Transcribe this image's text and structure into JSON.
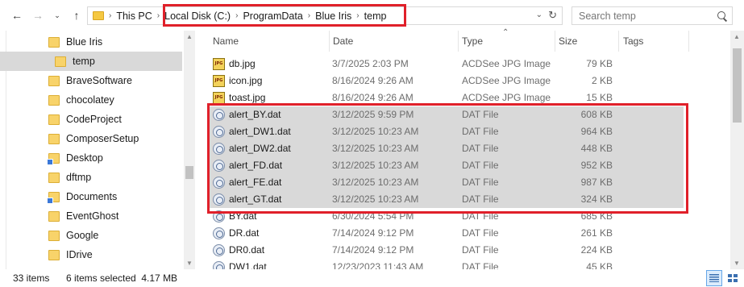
{
  "address_bar": {
    "back_icon": "arrow-left-icon",
    "forward_icon": "arrow-right-icon",
    "recent_icon": "chevron-down-icon",
    "up_icon": "arrow-up-icon",
    "crumbs": [
      "This PC",
      "Local Disk (C:)",
      "ProgramData",
      "Blue Iris",
      "temp"
    ],
    "search_placeholder": "Search temp"
  },
  "nav_pane": {
    "items": [
      {
        "label": "Blue Iris",
        "icon": "folder-icon"
      },
      {
        "label": "temp",
        "icon": "folder-icon",
        "selected": true
      },
      {
        "label": "BraveSoftware",
        "icon": "folder-icon"
      },
      {
        "label": "chocolatey",
        "icon": "folder-icon"
      },
      {
        "label": "CodeProject",
        "icon": "folder-icon"
      },
      {
        "label": "ComposerSetup",
        "icon": "folder-icon"
      },
      {
        "label": "Desktop",
        "icon": "system-folder-icon"
      },
      {
        "label": "dftmp",
        "icon": "folder-icon"
      },
      {
        "label": "Documents",
        "icon": "system-folder-icon"
      },
      {
        "label": "EventGhost",
        "icon": "folder-icon"
      },
      {
        "label": "Google",
        "icon": "folder-icon"
      },
      {
        "label": "IDrive",
        "icon": "folder-icon"
      }
    ]
  },
  "file_list": {
    "columns": [
      "Name",
      "Date",
      "Type",
      "Size",
      "Tags"
    ],
    "rows": [
      {
        "name": "db.jpg",
        "date": "3/7/2025 2:03 PM",
        "type": "ACDSee JPG Image",
        "size": "79 KB",
        "icon": "jpg-file-icon",
        "selected": false
      },
      {
        "name": "icon.jpg",
        "date": "8/16/2024 9:26 AM",
        "type": "ACDSee JPG Image",
        "size": "2 KB",
        "icon": "jpg-file-icon",
        "selected": false
      },
      {
        "name": "toast.jpg",
        "date": "8/16/2024 9:26 AM",
        "type": "ACDSee JPG Image",
        "size": "15 KB",
        "icon": "jpg-file-icon",
        "selected": false
      },
      {
        "name": "alert_BY.dat",
        "date": "3/12/2025 9:59 PM",
        "type": "DAT File",
        "size": "608 KB",
        "icon": "dat-file-icon",
        "selected": true
      },
      {
        "name": "alert_DW1.dat",
        "date": "3/12/2025 10:23 AM",
        "type": "DAT File",
        "size": "964 KB",
        "icon": "dat-file-icon",
        "selected": true
      },
      {
        "name": "alert_DW2.dat",
        "date": "3/12/2025 10:23 AM",
        "type": "DAT File",
        "size": "448 KB",
        "icon": "dat-file-icon",
        "selected": true
      },
      {
        "name": "alert_FD.dat",
        "date": "3/12/2025 10:23 AM",
        "type": "DAT File",
        "size": "952 KB",
        "icon": "dat-file-icon",
        "selected": true
      },
      {
        "name": "alert_FE.dat",
        "date": "3/12/2025 10:23 AM",
        "type": "DAT File",
        "size": "987 KB",
        "icon": "dat-file-icon",
        "selected": true
      },
      {
        "name": "alert_GT.dat",
        "date": "3/12/2025 10:23 AM",
        "type": "DAT File",
        "size": "324 KB",
        "icon": "dat-file-icon",
        "selected": true
      },
      {
        "name": "BY.dat",
        "date": "6/30/2024 5:54 PM",
        "type": "DAT File",
        "size": "685 KB",
        "icon": "dat-file-icon",
        "selected": false
      },
      {
        "name": "DR.dat",
        "date": "7/14/2024 9:12 PM",
        "type": "DAT File",
        "size": "261 KB",
        "icon": "dat-file-icon",
        "selected": false
      },
      {
        "name": "DR0.dat",
        "date": "7/14/2024 9:12 PM",
        "type": "DAT File",
        "size": "224 KB",
        "icon": "dat-file-icon",
        "selected": false
      },
      {
        "name": "DW1.dat",
        "date": "12/23/2023 11:43 AM",
        "type": "DAT File",
        "size": "45 KB",
        "icon": "dat-file-icon",
        "selected": false
      }
    ]
  },
  "status_bar": {
    "item_count": "33 items",
    "selection": "6 items selected  4.17 MB",
    "view_icons": [
      "details-view-icon",
      "large-icons-view-icon"
    ]
  },
  "colors": {
    "highlight_box": "#e0202a",
    "selection_bg": "#d9d9d9",
    "folder": "#f8d36a"
  }
}
